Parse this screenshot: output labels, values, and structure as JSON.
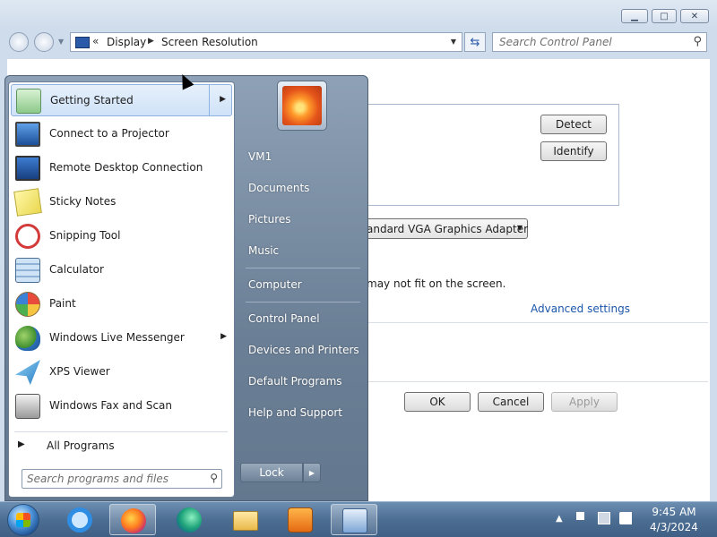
{
  "window": {
    "breadcrumb": [
      "Display",
      "Screen Resolution"
    ],
    "search_placeholder": "Search Control Panel",
    "detect_label": "Detect",
    "identify_label": "Identify",
    "display_select_value": "andard VGA Graphics Adapter",
    "fit_text": "may not fit on the screen.",
    "advanced_link": "Advanced settings",
    "ok_label": "OK",
    "cancel_label": "Cancel",
    "apply_label": "Apply"
  },
  "start_menu": {
    "programs": [
      {
        "label": "Getting Started",
        "icon": "getting-started-icon",
        "submenu": true
      },
      {
        "label": "Connect to a Projector",
        "icon": "projector-icon",
        "submenu": false
      },
      {
        "label": "Remote Desktop Connection",
        "icon": "remote-desktop-icon",
        "submenu": false
      },
      {
        "label": "Sticky Notes",
        "icon": "sticky-notes-icon",
        "submenu": false
      },
      {
        "label": "Snipping Tool",
        "icon": "snipping-tool-icon",
        "submenu": false
      },
      {
        "label": "Calculator",
        "icon": "calculator-icon",
        "submenu": false
      },
      {
        "label": "Paint",
        "icon": "paint-icon",
        "submenu": false
      },
      {
        "label": "Windows Live Messenger",
        "icon": "messenger-icon",
        "submenu": true
      },
      {
        "label": "XPS Viewer",
        "icon": "xps-viewer-icon",
        "submenu": false
      },
      {
        "label": "Windows Fax and Scan",
        "icon": "fax-scan-icon",
        "submenu": false
      }
    ],
    "all_programs_label": "All Programs",
    "search_placeholder": "Search programs and files",
    "right_items": [
      "VM1",
      "Documents",
      "Pictures",
      "Music",
      "Computer",
      "Control Panel",
      "Devices and Printers",
      "Default Programs",
      "Help and Support"
    ],
    "lock_label": "Lock"
  },
  "taskbar": {
    "apps": [
      "internet-explorer-icon",
      "firefox-icon",
      "edge-icon",
      "file-explorer-icon",
      "media-player-icon",
      "control-panel-icon"
    ],
    "time": "9:45 AM",
    "date": "4/3/2024"
  },
  "colors": {
    "link": "#1a55a8",
    "highlight": "#cfe2f8",
    "taskbar": "#4d6e93"
  }
}
